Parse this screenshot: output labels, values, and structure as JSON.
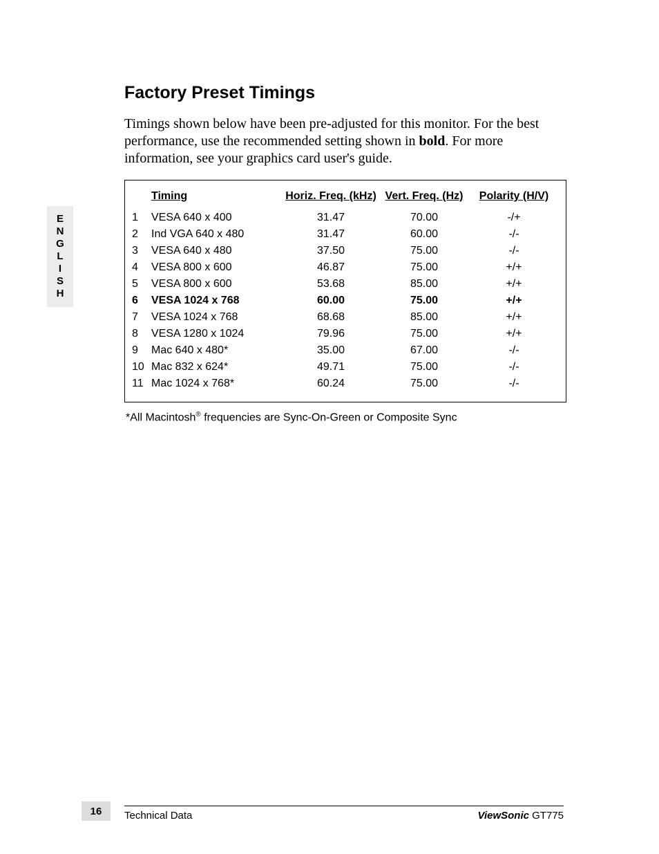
{
  "side_tab": [
    "E",
    "N",
    "G",
    "L",
    "I",
    "S",
    "H"
  ],
  "title": "Factory Preset Timings",
  "intro_parts": {
    "p1": "Timings shown below have been pre-adjusted for this monitor. For the best performance, use the recommended setting shown in ",
    "bold": "bold",
    "p2": ". For more information, see your graphics card user's guide."
  },
  "headers": {
    "timing": "Timing",
    "hfreq": "Horiz. Freq. (kHz)",
    "vfreq": "Vert. Freq.  (Hz)",
    "polarity": "Polarity (H/V)"
  },
  "rows": [
    {
      "n": "1",
      "timing": "VESA 640 x 400",
      "hfreq": "31.47",
      "vfreq": "70.00",
      "pol": "-/+",
      "bold": false
    },
    {
      "n": "2",
      "timing": "Ind VGA 640 x 480",
      "hfreq": "31.47",
      "vfreq": "60.00",
      "pol": "-/-",
      "bold": false
    },
    {
      "n": "3",
      "timing": "VESA 640 x 480",
      "hfreq": "37.50",
      "vfreq": "75.00",
      "pol": "-/-",
      "bold": false
    },
    {
      "n": "4",
      "timing": "VESA 800 x 600",
      "hfreq": "46.87",
      "vfreq": "75.00",
      "pol": "+/+",
      "bold": false
    },
    {
      "n": "5",
      "timing": "VESA 800 x 600",
      "hfreq": "53.68",
      "vfreq": "85.00",
      "pol": "+/+",
      "bold": false
    },
    {
      "n": "6",
      "timing": "VESA 1024 x 768",
      "hfreq": "60.00",
      "vfreq": "75.00",
      "pol": "+/+",
      "bold": true
    },
    {
      "n": "7",
      "timing": "VESA 1024 x 768",
      "hfreq": "68.68",
      "vfreq": "85.00",
      "pol": "+/+",
      "bold": false
    },
    {
      "n": "8",
      "timing": "VESA 1280 x 1024",
      "hfreq": "79.96",
      "vfreq": "75.00",
      "pol": "+/+",
      "bold": false
    },
    {
      "n": "9",
      "timing": "Mac 640 x 480*",
      "hfreq": "35.00",
      "vfreq": "67.00",
      "pol": "-/-",
      "bold": false
    },
    {
      "n": "10",
      "timing": "Mac 832 x 624*",
      "hfreq": "49.71",
      "vfreq": "75.00",
      "pol": "-/-",
      "bold": false
    },
    {
      "n": "11",
      "timing": "Mac 1024 x 768*",
      "hfreq": "60.24",
      "vfreq": "75.00",
      "pol": "-/-",
      "bold": false
    }
  ],
  "footnote": {
    "pre": "*All Macintosh",
    "reg": "®",
    "post": " frequencies are Sync-On-Green or Composite Sync"
  },
  "footer": {
    "page_num": "16",
    "section": "Technical Data",
    "brand": "ViewSonic",
    "model": " GT775"
  }
}
